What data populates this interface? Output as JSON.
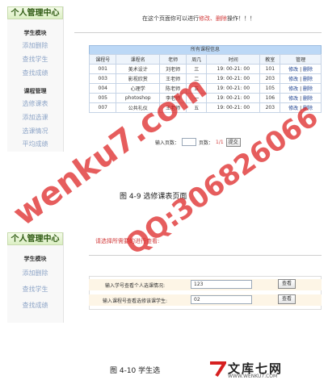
{
  "fig1": {
    "sidebar": {
      "header": "个人管理中心",
      "title": "学生模块",
      "links": [
        "添加删除",
        "查找学生",
        "查找成绩"
      ],
      "title2": "课程管理",
      "links2": [
        "选修课表",
        "添加选课",
        "选课情况",
        "平均成绩"
      ]
    },
    "notice_prefix": "在这个页面你可以进行",
    "notice_red1": "修改、",
    "notice_red2": "删除",
    "notice_suffix": "操作！！！",
    "table": {
      "caption": "所有课程信息",
      "headers": [
        "课程号",
        "课程名",
        "老师",
        "周几",
        "时间",
        "教室",
        "管理"
      ],
      "rows": [
        [
          "001",
          "美术设计",
          "刘老师",
          "三",
          "19: 00-21: 00",
          "101"
        ],
        [
          "003",
          "影视欣赏",
          "王老师",
          "二",
          "19: 00-21: 00",
          "203"
        ],
        [
          "004",
          "心理学",
          "陈老师",
          "五",
          "19: 00-21: 00",
          "105"
        ],
        [
          "005",
          "photoshop",
          "李老师",
          "一",
          "19: 00-21: 00",
          "106"
        ],
        [
          "007",
          "公共礼仪",
          "王老师",
          "五",
          "19: 00-21: 00",
          "203"
        ]
      ],
      "edit": "修改",
      "sep": "|",
      "delete": "删除"
    },
    "pager": {
      "input_label": "输入页数：",
      "page_label": "页数：",
      "page_value": "1/1",
      "submit": "提交"
    },
    "caption": "图 4-9   选修课表页面"
  },
  "fig2": {
    "sidebar": {
      "header": "个人管理中心",
      "title": "学生模块",
      "links": [
        "添加删除",
        "查找学生",
        "查找成绩"
      ]
    },
    "notice": "请选择所需要的进行查看:",
    "row1": {
      "label": "输入学号查看个人选课情况:",
      "value": "123",
      "button": "查看"
    },
    "row2": {
      "label": "输入课程号查看选修该课学生:",
      "value": "02",
      "button": "查看"
    },
    "caption": "图 4-10  学生选"
  },
  "watermark": {
    "line1": "wenku7.com",
    "line2": "QQ:306826066"
  },
  "logo": {
    "name": "文库七网",
    "url": "WWW.WENKU7.COM"
  }
}
